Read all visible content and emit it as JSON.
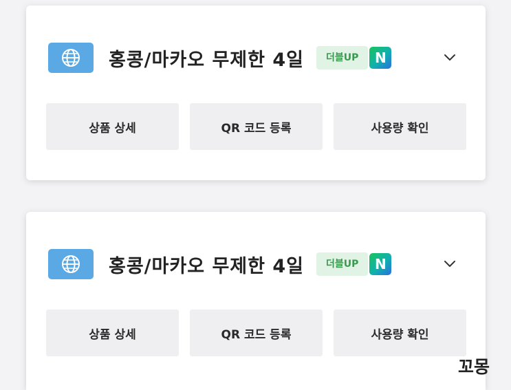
{
  "plans": [
    {
      "icon": "globe-icon",
      "title": "홍콩/마카오 무제한 4일",
      "badge_up": "더블UP",
      "badge_n": "N",
      "expand_icon": "chevron-down-icon",
      "buttons": {
        "detail": "상품 상세",
        "qr": "QR 코드 등록",
        "usage": "사용량 확인"
      }
    },
    {
      "icon": "globe-icon",
      "title": "홍콩/마카오 무제한 4일",
      "badge_up": "더블UP",
      "badge_n": "N",
      "expand_icon": "chevron-down-icon",
      "buttons": {
        "detail": "상품 상세",
        "qr": "QR 코드 등록",
        "usage": "사용량 확인"
      }
    }
  ],
  "watermark": "꼬몽",
  "colors": {
    "icon_box": "#5aa8e4",
    "badge_up_bg": "#e0f3e4",
    "badge_up_text": "#3a9a50",
    "button_bg": "#efeff1"
  }
}
